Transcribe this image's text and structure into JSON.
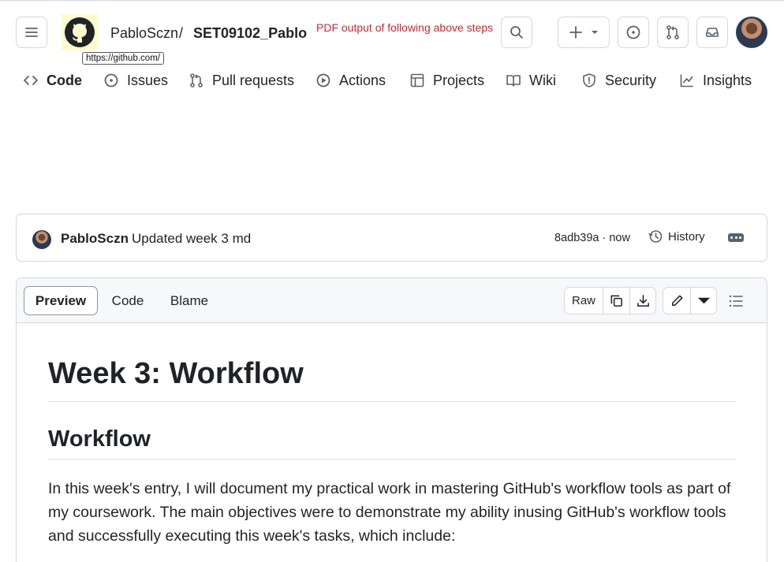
{
  "header": {
    "owner": "PabloSczn",
    "separator": "/",
    "repo": "SET09102_Pablo",
    "tooltip": "https://github.com/",
    "annotation": "PDF output of following above steps"
  },
  "icons": {
    "menu": "hamburger-icon",
    "logo": "github-logo-icon",
    "search": "search-icon",
    "create": "plus-icon",
    "issues": "issue-opened-icon",
    "pulls": "git-pull-request-icon",
    "inbox": "inbox-icon"
  },
  "nav": {
    "items": [
      {
        "label": "Code",
        "icon": "code-icon",
        "active": true
      },
      {
        "label": "Issues",
        "icon": "issue-opened-icon"
      },
      {
        "label": "Pull requests",
        "icon": "git-pull-request-icon"
      },
      {
        "label": "Actions",
        "icon": "play-icon"
      },
      {
        "label": "Projects",
        "icon": "table-icon"
      },
      {
        "label": "Wiki",
        "icon": "book-icon"
      },
      {
        "label": "Security",
        "icon": "shield-icon"
      },
      {
        "label": "Insights",
        "icon": "graph-icon"
      }
    ]
  },
  "commit": {
    "author": "PabloSczn",
    "message": "Updated week 3 md",
    "sha_time": "8adb39a · now",
    "history_label": "History"
  },
  "file": {
    "tabs": {
      "preview": "Preview",
      "code": "Code",
      "blame": "Blame"
    },
    "raw_label": "Raw"
  },
  "content": {
    "h1": "Week 3: Workflow",
    "h2": "Workflow",
    "paragraph": "In this week's entry, I will document my practical work in mastering GitHub's workflow tools as part of my coursework. The main objectives were to demonstrate my ability inusing GitHub's workflow tools and successfully executing this week's tasks, which include:"
  },
  "colors": {
    "border": "#d1d9e0",
    "text": "#1f2328",
    "muted": "#59636e",
    "annotation": "#d1242f",
    "logo_highlight": "#fffbcc"
  }
}
